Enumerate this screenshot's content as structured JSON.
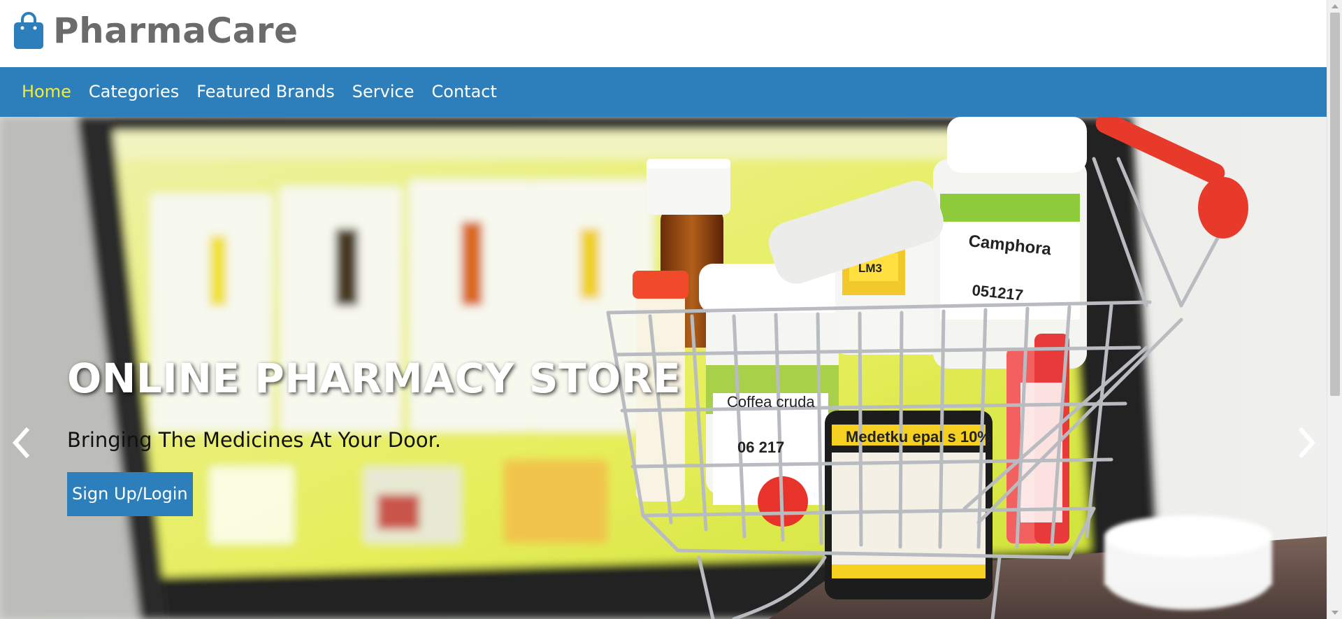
{
  "header": {
    "brand_name": "PharmaCare",
    "brand_icon": "shopping-bag-icon",
    "brand_color": "#2c7fba"
  },
  "nav": {
    "items": [
      {
        "label": "Home",
        "active": true
      },
      {
        "label": "Categories",
        "active": false
      },
      {
        "label": "Featured Brands",
        "active": false
      },
      {
        "label": "Service",
        "active": false
      },
      {
        "label": "Contact",
        "active": false
      }
    ],
    "background": "#2c7fba",
    "active_color": "#f5ea3b"
  },
  "hero": {
    "title": "ONLINE PHARMACY STORE",
    "subtitle": "Bringing The Medicines At Your Door.",
    "button_label": "Sign Up/Login",
    "labels": {
      "camphora": "Camphora",
      "camphora_code": "051217",
      "lm3": "LM3",
      "coffea": "Coffea cruda",
      "coffea_code": "06 217",
      "medetku": "Medetku epal s 10%"
    },
    "prev_icon": "chevron-left-icon",
    "next_icon": "chevron-right-icon"
  }
}
